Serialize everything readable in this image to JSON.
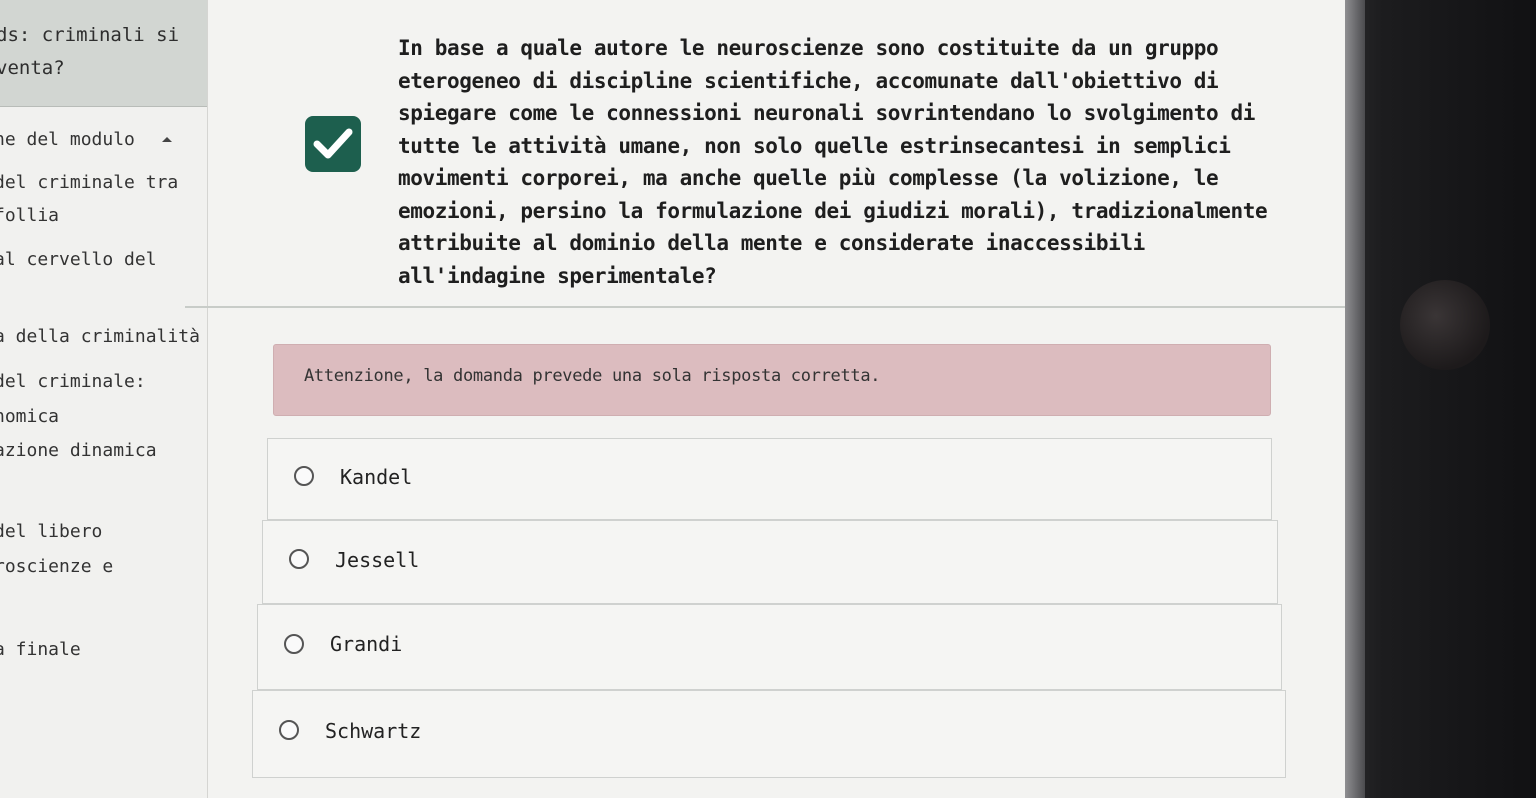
{
  "sidebar": {
    "header_lines": [
      "ds: criminali si",
      "venta?"
    ],
    "items": [
      "ne del modulo",
      "del criminale tra",
      "follia",
      "al cervello del",
      "a della criminalità",
      "del criminale:",
      "nomica",
      "azione dinamica",
      "del libero",
      "roscienze e",
      "a finale"
    ]
  },
  "question": {
    "text": "In base a quale autore le neuroscienze sono costituite da un gruppo eterogeneo di discipline scientifiche, accomunate dall'obiettivo di spiegare come le connessioni neuronali sovrintendano lo svolgimento di tutte le attività umane, non solo quelle estrinsecantesi in semplici movimenti corporei, ma anche quelle più complesse (la volizione, le emozioni, persino la formulazione dei giudizi morali), tradizionalmente attribuite al dominio della mente e considerate inaccessibili all'indagine sperimentale?",
    "status_icon": "checkmark-icon",
    "status_color": "#1d5f4e"
  },
  "warning": {
    "text": "Attenzione, la domanda prevede una sola risposta corretta.",
    "color": "#dcbcbf"
  },
  "options": [
    {
      "label": "Kandel"
    },
    {
      "label": "Jessell"
    },
    {
      "label": "Grandi"
    },
    {
      "label": "Schwartz"
    }
  ]
}
